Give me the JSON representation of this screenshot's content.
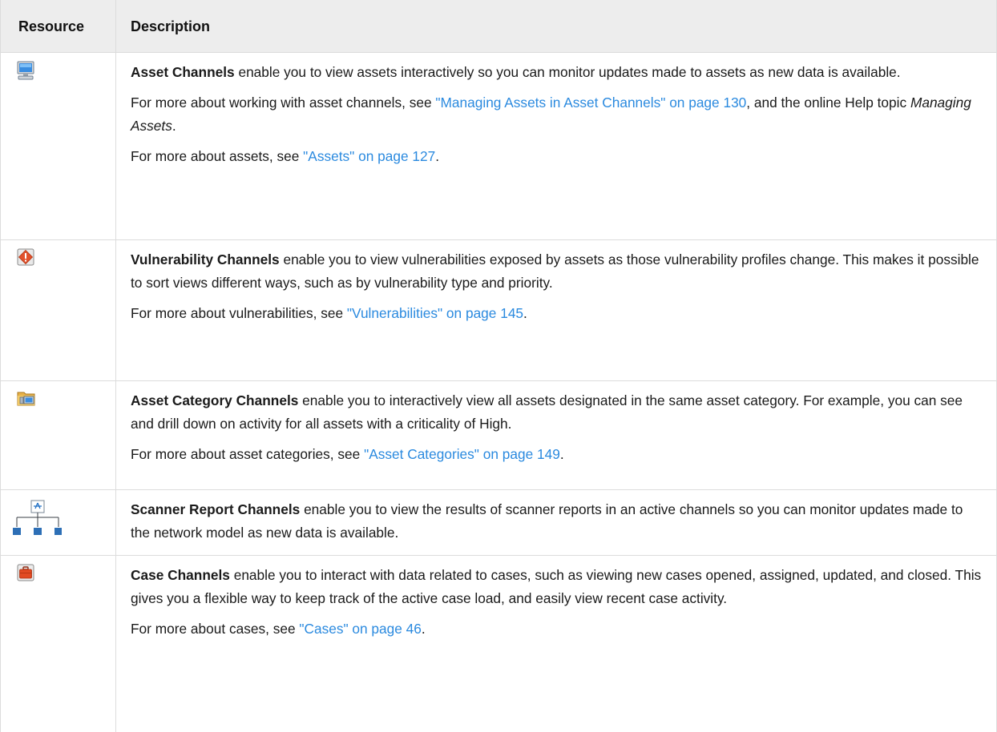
{
  "table": {
    "headers": {
      "resource": "Resource",
      "description": "Description"
    },
    "rows": [
      {
        "icon": "asset-computer-icon",
        "term": "Asset Channels",
        "lead": " enable you to view assets interactively so you can monitor updates made to assets as new data is available.",
        "p2_pre": "For more about working with asset channels, see ",
        "p2_link": "\"Managing Assets in Asset Channels\" on page 130",
        "p2_mid": ", and the online Help topic ",
        "p2_italic": "Managing Assets",
        "p2_end": ".",
        "p3_pre": "For more about assets, see ",
        "p3_link": "\"Assets\" on page 127",
        "p3_end": "."
      },
      {
        "icon": "vulnerability-warning-icon",
        "term": "Vulnerability Channels",
        "lead": " enable you to view vulnerabilities exposed by assets as those vulnerability profiles change. This makes it possible to sort views different ways, such as by vulnerability type and priority.",
        "p2_pre": "For more about vulnerabilities, see ",
        "p2_link": "\"Vulnerabilities\" on page 145",
        "p2_end": "."
      },
      {
        "icon": "asset-category-folder-icon",
        "term": "Asset Category Channels",
        "lead": " enable you to interactively view all assets designated in the same asset category. For example, you can see and drill down on activity for all assets with a criticality of High.",
        "p2_pre": "For more about asset categories, see ",
        "p2_link": "\"Asset Categories\" on page 149",
        "p2_end": "."
      },
      {
        "icon": "scanner-network-icon",
        "term": "Scanner Report Channels",
        "lead": " enable you to view the results of scanner reports in an active channels so you can monitor updates made to the network model as new data is available."
      },
      {
        "icon": "case-briefcase-icon",
        "term": "Case Channels",
        "lead": " enable you to interact with data related to cases, such as viewing new cases opened, assigned, updated, and closed. This gives you a flexible way to keep track of the active case load, and easily view recent case activity.",
        "p2_pre": "For more about cases, see ",
        "p2_link": "\"Cases\" on page 46",
        "p2_end": "."
      }
    ]
  },
  "colors": {
    "link": "#2b8adf",
    "header_bg": "#ededed",
    "border": "#dcdcdc"
  }
}
